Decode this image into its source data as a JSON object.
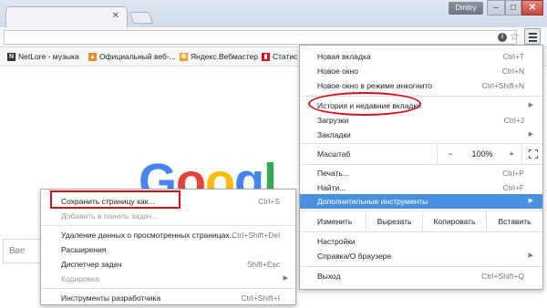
{
  "window": {
    "user": "Dmitry",
    "tab_close": "✕"
  },
  "toolbar": {
    "star": "☆"
  },
  "bookmarks": [
    {
      "label": "NetLore - музыка",
      "color": "#333333",
      "glyph": "N"
    },
    {
      "label": "Официальный веб-...",
      "color": "#f08a24",
      "glyph": "▲"
    },
    {
      "label": "Яндекс.Вебмастер",
      "color": "#f0a020",
      "glyph": "⚙"
    },
    {
      "label": "Статис",
      "color": "#d9101a",
      "glyph": "▮"
    }
  ],
  "page": {
    "logo_letters": [
      "G",
      "o",
      "o",
      "g",
      "l"
    ],
    "logo_colors": [
      "#4285f4",
      "#ea4335",
      "#fbbc05",
      "#4285f4",
      "#34a853"
    ],
    "search_placeholder": "Вве"
  },
  "menu": {
    "items_top": [
      {
        "label": "Новая вкладка",
        "shortcut": "Ctrl+T"
      },
      {
        "label": "Новое окно",
        "shortcut": "Ctrl+N"
      },
      {
        "label": "Новое окно в режиме инкогнито",
        "shortcut": "Ctrl+Shift+N"
      }
    ],
    "history": {
      "label": "История и недавние вкладки",
      "arrow": "▶"
    },
    "downloads": {
      "label": "Загрузки",
      "shortcut": "Ctrl+J"
    },
    "bookmarks": {
      "label": "Закладки",
      "arrow": "▶"
    },
    "zoom": {
      "label": "Масштаб",
      "minus": "−",
      "value": "100%",
      "plus": "+"
    },
    "print": {
      "label": "Печать...",
      "shortcut": "Ctrl+P"
    },
    "find": {
      "label": "Найти...",
      "shortcut": "Ctrl+F"
    },
    "more_tools": {
      "label": "Дополнительные инструменты",
      "arrow": "▶"
    },
    "edit": {
      "label": "Изменить",
      "cut": "Вырезать",
      "copy": "Копировать",
      "paste": "Вставить"
    },
    "settings": {
      "label": "Настройки"
    },
    "help": {
      "label": "Справка/О браузере",
      "arrow": "▶"
    },
    "exit": {
      "label": "Выход",
      "shortcut": "Ctrl+Shift+Q"
    },
    "highlight_color": "#4a90e2",
    "annotation_color": "#d9101a"
  },
  "submenu": {
    "items": [
      {
        "label": "Сохранить страницу как...",
        "shortcut": "Ctrl+S",
        "disabled": false
      },
      {
        "label": "Добавить в панель задач...",
        "shortcut": "",
        "disabled": true
      },
      {
        "label": "Удаление данных о просмотренных страницах...",
        "shortcut": "Ctrl+Shift+Del",
        "disabled": false
      },
      {
        "label": "Расширения",
        "shortcut": "",
        "disabled": false
      },
      {
        "label": "Диспетчер задач",
        "shortcut": "Shift+Esc",
        "disabled": false
      },
      {
        "label": "Кодировка",
        "shortcut": "",
        "disabled": true,
        "arrow": "▶"
      },
      {
        "label": "Инструменты разработчика",
        "shortcut": "Ctrl+Shift+I",
        "disabled": false
      }
    ]
  }
}
